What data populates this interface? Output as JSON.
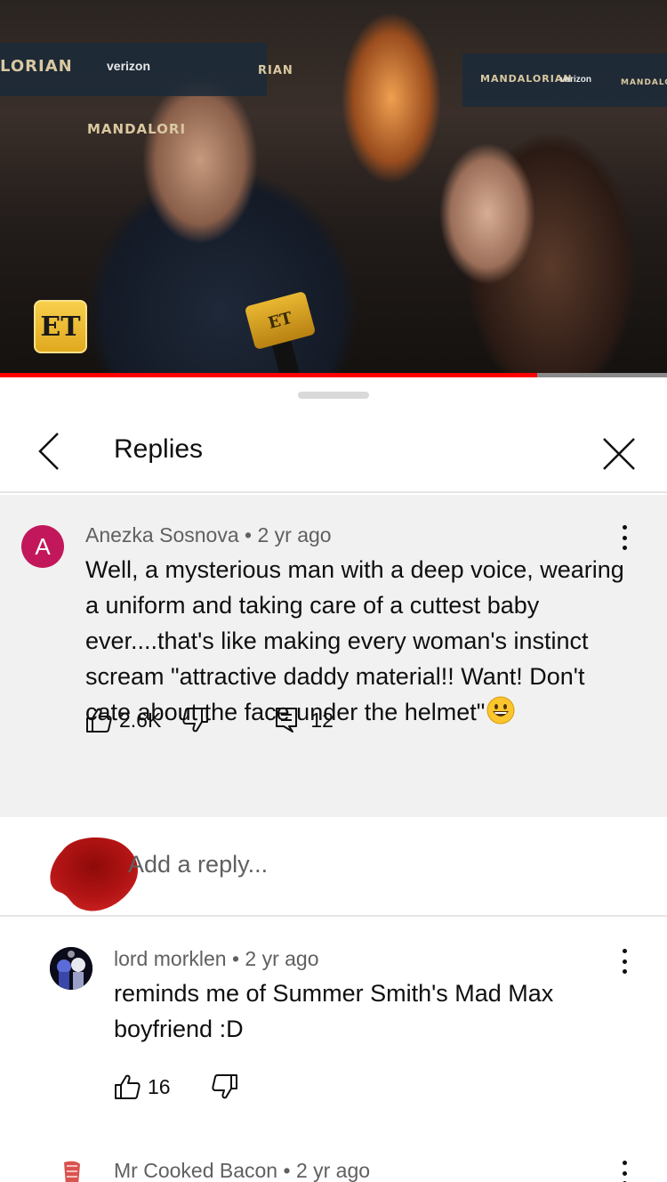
{
  "video": {
    "channel_logo": "ET",
    "mic_logo": "ET",
    "backdrop_texts": [
      "LORIAN",
      "verizon",
      "MANDALORI",
      "RIAN",
      "MANDALORIAN",
      "verizon",
      "MANDALORIAN"
    ],
    "progress_fraction": 0.805,
    "accent_color": "#ff0000"
  },
  "panel": {
    "title": "Replies",
    "back_icon": "chevron-left-icon",
    "close_icon": "close-icon"
  },
  "parent_comment": {
    "avatar_letter": "A",
    "avatar_color": "#c2185b",
    "author": "Anezka Sosnova",
    "separator": "•",
    "time": "2 yr ago",
    "text_lines": [
      "Well, a mysterious man with a deep voice, wearing",
      "a uniform and taking care of a cuttest baby",
      "ever....that's like making every woman's instinct",
      "scream \"attractive daddy material!! Want! Don't",
      "cate about the face under the helmet\""
    ],
    "emoji": "grinning-face-emoji",
    "likes": "2.6K",
    "replies_count": "12"
  },
  "composer": {
    "placeholder": "Add a reply..."
  },
  "replies": [
    {
      "author": "lord morklen",
      "separator": "•",
      "time": "2 yr ago",
      "text_lines": [
        "reminds me of Summer Smith's Mad Max",
        "boyfriend :D"
      ],
      "likes": "16"
    },
    {
      "author": "Mr Cooked Bacon",
      "separator": "•",
      "time": "2 yr ago"
    }
  ]
}
